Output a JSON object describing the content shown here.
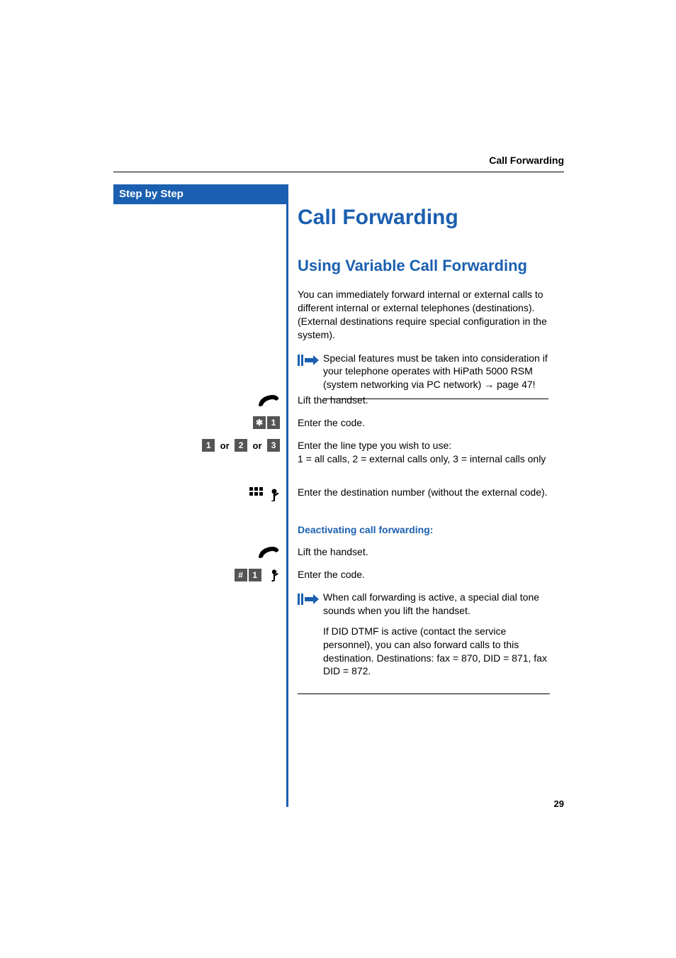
{
  "header": {
    "label": "Call Forwarding"
  },
  "sidebar": {
    "label": "Step by Step"
  },
  "title": "Call Forwarding",
  "subtitle": "Using Variable Call Forwarding",
  "intro": "You can immediately forward internal or external calls to different internal or external telephones (destinations). (External destinations require special configuration in the system).",
  "note1": {
    "text": "Special features must be taken into consideration if your telephone operates with HiPath 5000 RSM (system networking via PC network) ",
    "page_ref": "page 47!"
  },
  "steps": [
    {
      "icon": "handset",
      "text": "Lift the handset."
    },
    {
      "icon": "star1",
      "text": "Enter the code."
    },
    {
      "icon": "choice123",
      "text": "Enter the line type you wish to use:\n1 = all calls, 2 = external calls only, 3 = internal calls only"
    },
    {
      "icon": "keypad-note",
      "text": "Enter the destination number (without the external code)."
    }
  ],
  "deactivate_heading": "Deactivating call forwarding:",
  "steps2": [
    {
      "icon": "handset",
      "text": "Lift the handset."
    },
    {
      "icon": "hash1-note",
      "text": "Enter the code."
    }
  ],
  "note2": {
    "p1": "When call forwarding is active, a special dial tone sounds when you lift the handset.",
    "p2": "If DID DTMF is active (contact the service personnel), you can also forward calls to this destination. Destinations: fax = 870, DID = 871, fax DID = 872."
  },
  "keys": {
    "star": "✱",
    "hash": "#",
    "one": "1",
    "two": "2",
    "three": "3",
    "or": "or"
  },
  "page_number": "29"
}
